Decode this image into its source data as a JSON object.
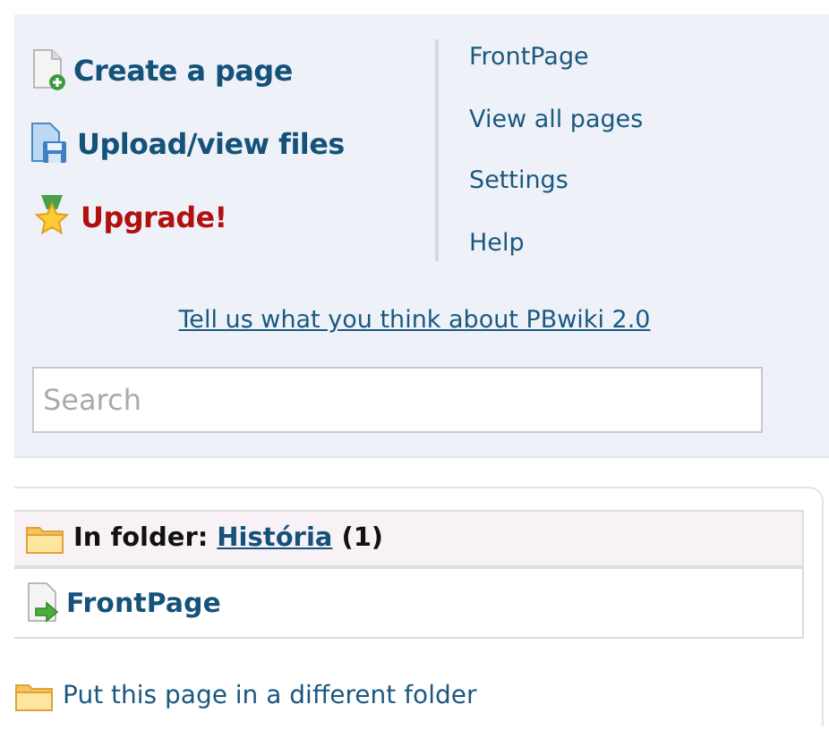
{
  "actions": [
    {
      "kind": "create",
      "label": "Create a page"
    },
    {
      "kind": "upload",
      "label": "Upload/view files"
    },
    {
      "kind": "upgrade",
      "label": "Upgrade!"
    }
  ],
  "nav_links": [
    "FrontPage",
    "View all pages",
    "Settings",
    "Help"
  ],
  "feedback_link": "Tell us what you think about PBwiki 2.0",
  "search": {
    "placeholder": "Search"
  },
  "folder": {
    "label": "In folder:",
    "name": "História",
    "count": "(1)",
    "pages": [
      "FrontPage"
    ]
  },
  "move_link": "Put this page in a different folder"
}
